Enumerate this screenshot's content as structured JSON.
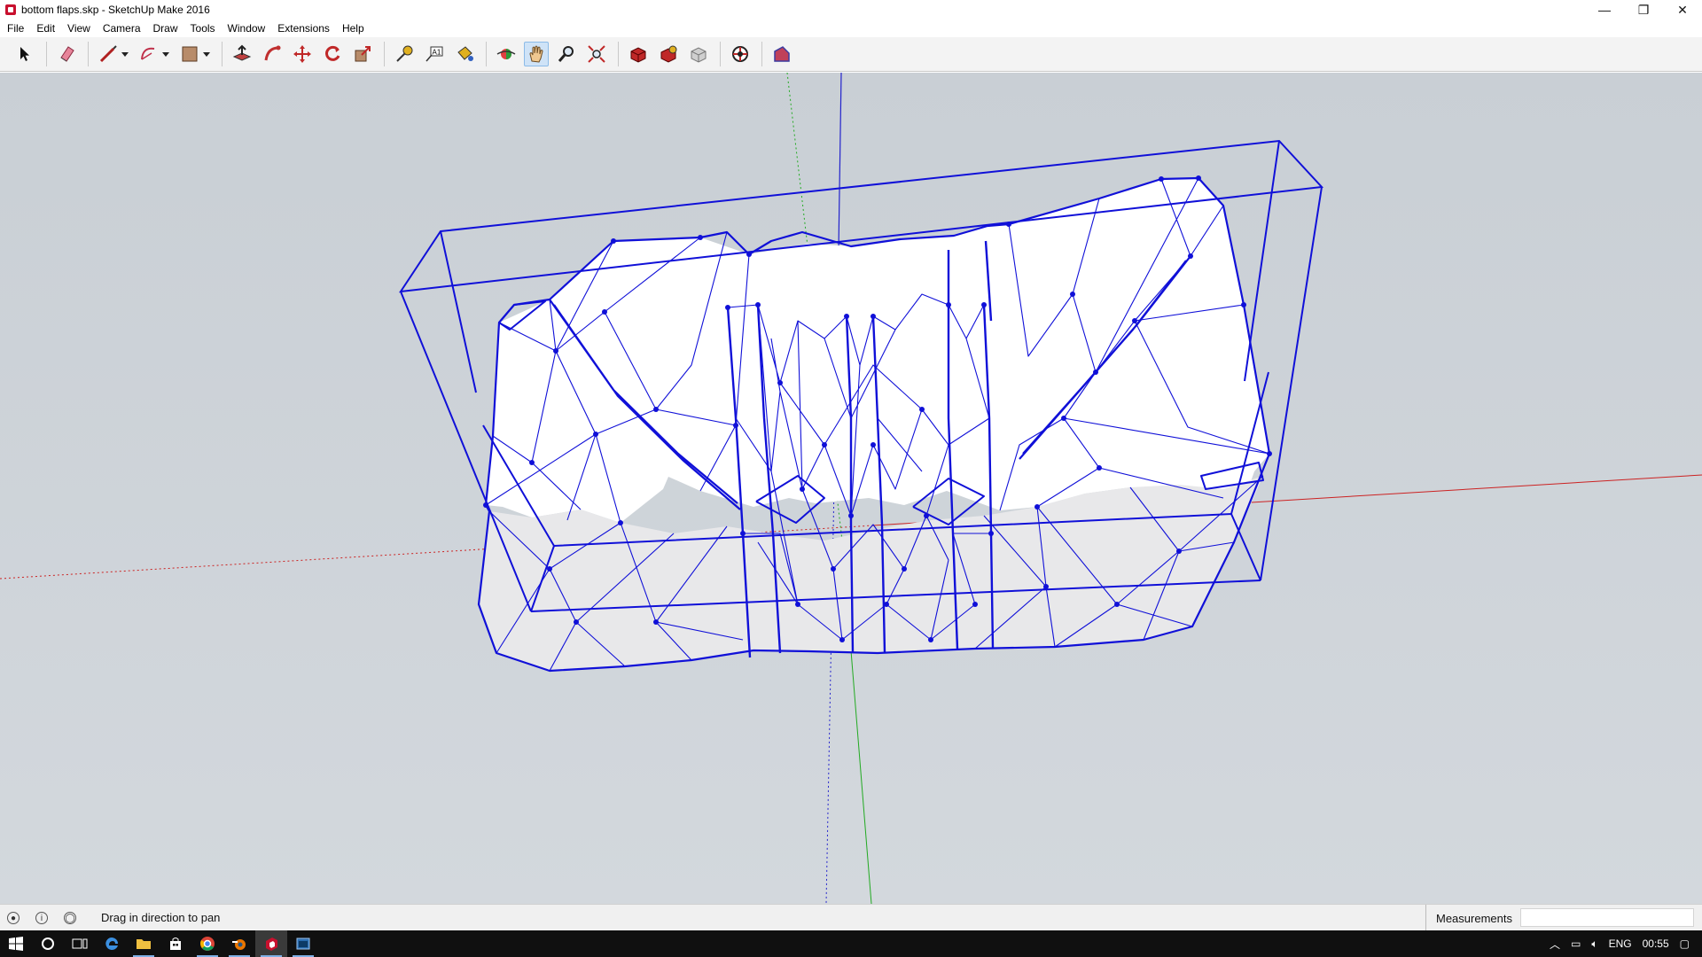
{
  "window": {
    "title": "bottom flaps.skp - SketchUp Make 2016",
    "controls": [
      "—",
      "❐",
      "✕"
    ]
  },
  "menu": [
    "File",
    "Edit",
    "View",
    "Camera",
    "Draw",
    "Tools",
    "Window",
    "Extensions",
    "Help"
  ],
  "toolbar": {
    "tools": [
      {
        "name": "select-tool-icon"
      },
      {
        "name": "eraser-tool-icon"
      },
      {
        "name": "line-tool-icon"
      },
      {
        "name": "arc-tool-icon"
      },
      {
        "name": "rectangle-tool-icon"
      },
      {
        "name": "push-pull-tool-icon"
      },
      {
        "name": "follow-me-tool-icon"
      },
      {
        "name": "move-tool-icon"
      },
      {
        "name": "rotate-tool-icon"
      },
      {
        "name": "scale-tool-icon"
      },
      {
        "name": "tape-measure-tool-icon"
      },
      {
        "name": "text-tool-icon"
      },
      {
        "name": "paint-bucket-tool-icon"
      },
      {
        "name": "orbit-tool-icon"
      },
      {
        "name": "pan-tool-icon",
        "active": true
      },
      {
        "name": "zoom-tool-icon"
      },
      {
        "name": "zoom-extents-tool-icon"
      },
      {
        "name": "warehouse-icon"
      },
      {
        "name": "share-model-icon"
      },
      {
        "name": "extension-warehouse-icon"
      },
      {
        "name": "layout-icon"
      },
      {
        "name": "section-plane-icon"
      }
    ],
    "text_tool_glyph": "A1"
  },
  "status": {
    "hint": "Drag in direction to pan",
    "measurements_label": "Measurements",
    "measurements_value": ""
  },
  "taskbar": {
    "tray": {
      "language": "ENG",
      "time": "00:55"
    }
  },
  "colors": {
    "viewport_bg": "#cdd3d9",
    "model_edges": "#1010d8",
    "axis_red": "#cc2222",
    "axis_green": "#22aa22",
    "axis_blue": "#2222cc"
  }
}
